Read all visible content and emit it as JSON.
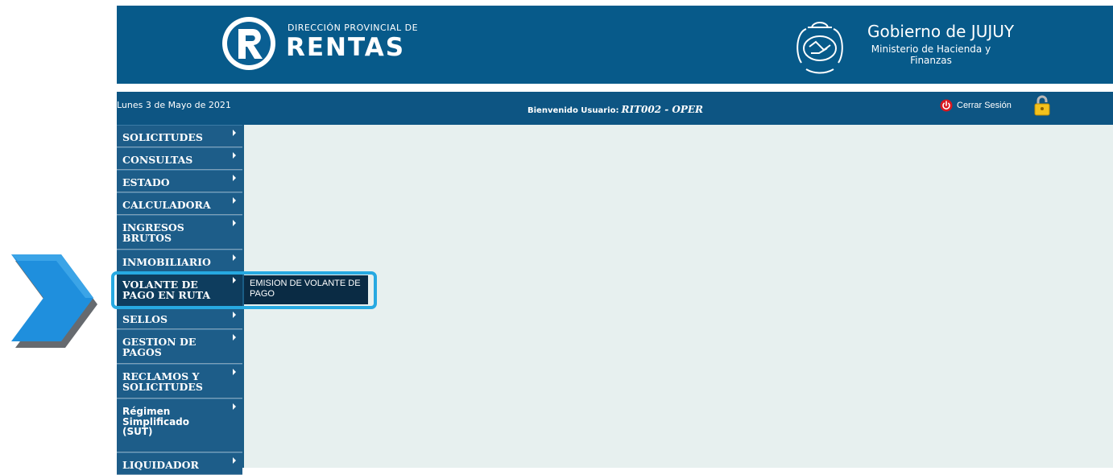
{
  "header": {
    "rentas_line1": "DIRECCIÓN PROVINCIAL DE",
    "rentas_line2": "RENTAS",
    "logo_icon": "rentas-r-logo",
    "gov_title": "Gobierno de JUJUY",
    "gov_sub": "Ministerio de Hacienda y Finanzas",
    "emblem_icon": "jujuy-emblem"
  },
  "status_bar": {
    "date": "Lunes 3 de Mayo de 2021",
    "welcome_label": "Bienvenido Usuario:",
    "user": "RIT002 - OPER",
    "logout_label": "Cerrar Sesión"
  },
  "menu": [
    {
      "label": "SOLICITUDES"
    },
    {
      "label": "CONSULTAS"
    },
    {
      "label": "ESTADO"
    },
    {
      "label": "CALCULADORA"
    },
    {
      "label": "INGRESOS BRUTOS"
    },
    {
      "label": "INMOBILIARIO"
    },
    {
      "label": "VOLANTE DE PAGO EN RUTA"
    },
    {
      "label": "SELLOS"
    },
    {
      "label": "GESTION DE PAGOS"
    },
    {
      "label": "RECLAMOS Y SOLICITUDES"
    },
    {
      "label": "Régimen Simplificado (SUT)"
    },
    {
      "label": "LIQUIDADOR"
    }
  ],
  "submenu": {
    "item": "EMISION DE VOLANTE DE PAGO"
  },
  "colors": {
    "header_bg": "#075a8a",
    "menu_bg": "#1d5d89",
    "content_bg": "#e7f0ef",
    "highlight": "#27a9e1",
    "submenu_bg": "#0a2b44"
  }
}
